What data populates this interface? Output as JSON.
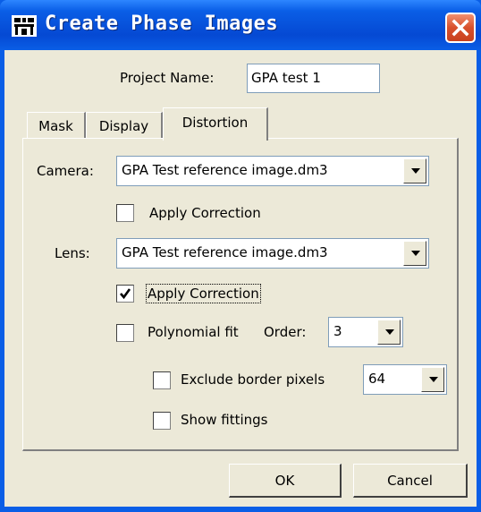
{
  "window": {
    "title": "Create Phase Images"
  },
  "project": {
    "label": "Project Name:",
    "value": "GPA test 1"
  },
  "tabs": [
    {
      "label": "Mask"
    },
    {
      "label": "Display"
    },
    {
      "label": "Distortion"
    }
  ],
  "distortion": {
    "camera_label": "Camera:",
    "camera_value": "GPA Test reference image.dm3",
    "camera_apply_label": "Apply Correction",
    "camera_apply_checked": false,
    "lens_label": "Lens:",
    "lens_value": "GPA Test reference image.dm3",
    "lens_apply_label": "Apply Correction",
    "lens_apply_checked": true,
    "poly_label": "Polynomial fit",
    "poly_checked": false,
    "order_label": "Order:",
    "order_value": "3",
    "exclude_label": "Exclude border pixels",
    "exclude_checked": false,
    "exclude_value": "64",
    "show_label": "Show fittings",
    "show_checked": false
  },
  "buttons": {
    "ok": "OK",
    "cancel": "Cancel"
  }
}
